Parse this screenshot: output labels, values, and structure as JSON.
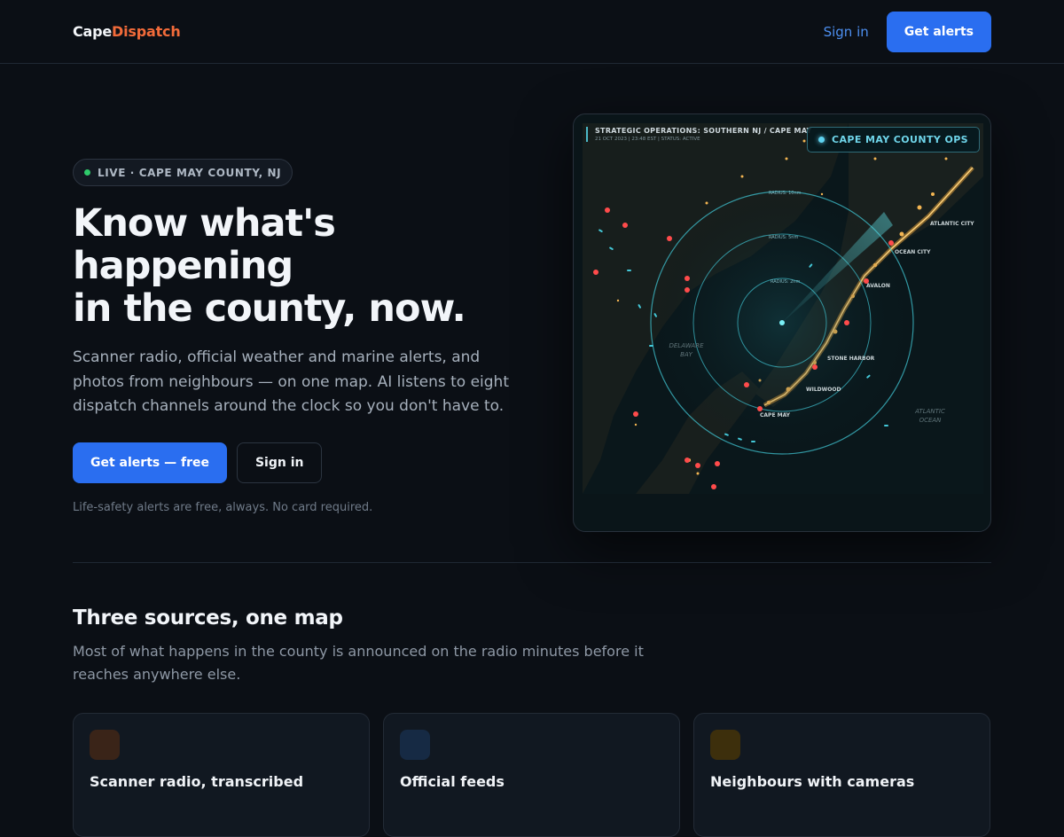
{
  "brand": {
    "part1": "Cape",
    "part2": "Dispatch",
    "accent": "#f26b3a"
  },
  "nav": {
    "signin_label": "Sign in",
    "cta_label": "Get alerts"
  },
  "hero": {
    "badge": "LIVE · CAPE MAY COUNTY, NJ",
    "title_line1": "Know what's happening",
    "title_line2": "in the county, now.",
    "description": "Scanner radio, official weather and marine alerts, and photos from neighbours — on one map. AI listens to eight dispatch channels around the clock so you don't have to.",
    "primary_cta": "Get alerts — free",
    "secondary_cta": "Sign in",
    "note": "Life-safety alerts are free, always. No card required."
  },
  "map": {
    "header_title": "STRATEGIC OPERATIONS: SOUTHERN NJ / CAPE MAY",
    "header_sub": "21 OCT 2023 | 23:48 EST | STATUS: ACTIVE",
    "badge": "CAPE MAY COUNTY OPS",
    "place_labels": [
      "ATLANTIC CITY",
      "OCEAN CITY",
      "AVALON",
      "STONE HARBOR",
      "WILDWOOD",
      "CAPE MAY",
      "DELAWARE BAY",
      "ATLANTIC OCEAN"
    ],
    "ring_labels": [
      "RADIUS: 10nm",
      "RADIUS: 5nm",
      "RADIUS: 2nm"
    ]
  },
  "sources": {
    "title": "Three sources, one map",
    "description": "Most of what happens in the county is announced on the radio minutes before it reaches anywhere else.",
    "cards": [
      {
        "title": "Scanner radio, transcribed",
        "icon": "radio-icon",
        "color": "#3a2418"
      },
      {
        "title": "Official feeds",
        "icon": "feed-icon",
        "color": "#162a44"
      },
      {
        "title": "Neighbours with cameras",
        "icon": "camera-icon",
        "color": "#3d2f0c"
      }
    ]
  },
  "colors": {
    "primary": "#2a6ef0",
    "background": "#0b0f15",
    "live": "#2fcb6b",
    "ops": "#6fd5ea"
  }
}
